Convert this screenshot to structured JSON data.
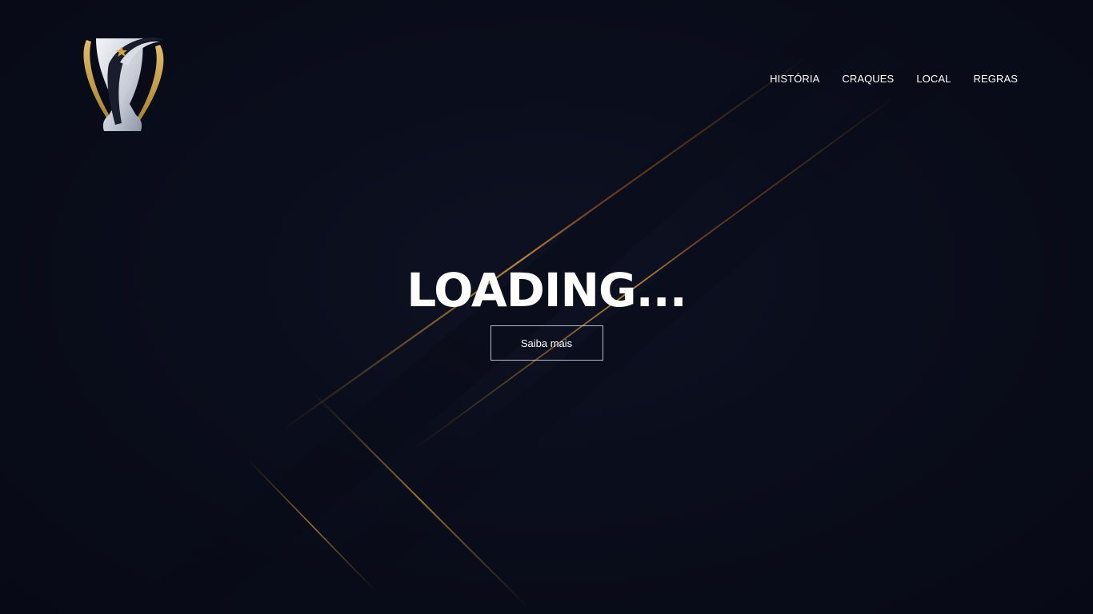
{
  "nav": {
    "items": [
      {
        "label": "HISTÓRIA"
      },
      {
        "label": "CRAQUES"
      },
      {
        "label": "LOCAL"
      },
      {
        "label": "REGRAS"
      }
    ]
  },
  "hero": {
    "title": "LOADING...",
    "button_label": "Saiba mais"
  },
  "logo": {
    "icon": "trophy-icon"
  },
  "colors": {
    "background": "#0a0d1a",
    "accent_gold": "#c9a24d",
    "text": "#ffffff"
  }
}
